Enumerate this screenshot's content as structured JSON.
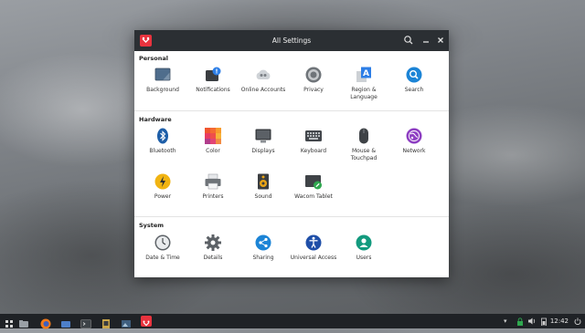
{
  "window": {
    "title": "All Settings",
    "accent": "#e8333e"
  },
  "sections": [
    {
      "title": "Personal",
      "items": [
        {
          "label": "Background",
          "icon": "background-icon"
        },
        {
          "label": "Notifications",
          "icon": "notifications-icon"
        },
        {
          "label": "Online Accounts",
          "icon": "online-accounts-icon"
        },
        {
          "label": "Privacy",
          "icon": "privacy-icon"
        },
        {
          "label": "Region & Language",
          "icon": "region-language-icon"
        },
        {
          "label": "Search",
          "icon": "search-icon"
        }
      ]
    },
    {
      "title": "Hardware",
      "items": [
        {
          "label": "Bluetooth",
          "icon": "bluetooth-icon"
        },
        {
          "label": "Color",
          "icon": "color-icon"
        },
        {
          "label": "Displays",
          "icon": "displays-icon"
        },
        {
          "label": "Keyboard",
          "icon": "keyboard-icon"
        },
        {
          "label": "Mouse & Touchpad",
          "icon": "mouse-icon"
        },
        {
          "label": "Network",
          "icon": "network-icon"
        },
        {
          "label": "Power",
          "icon": "power-icon"
        },
        {
          "label": "Printers",
          "icon": "printer-icon"
        },
        {
          "label": "Sound",
          "icon": "sound-icon"
        },
        {
          "label": "Wacom Tablet",
          "icon": "wacom-icon"
        }
      ]
    },
    {
      "title": "System",
      "items": [
        {
          "label": "Date & Time",
          "icon": "clock-icon"
        },
        {
          "label": "Details",
          "icon": "gear-icon"
        },
        {
          "label": "Sharing",
          "icon": "share-icon"
        },
        {
          "label": "Universal Access",
          "icon": "accessibility-icon"
        },
        {
          "label": "Users",
          "icon": "user-icon"
        }
      ]
    }
  ],
  "taskbar": {
    "clock": "12:42"
  }
}
